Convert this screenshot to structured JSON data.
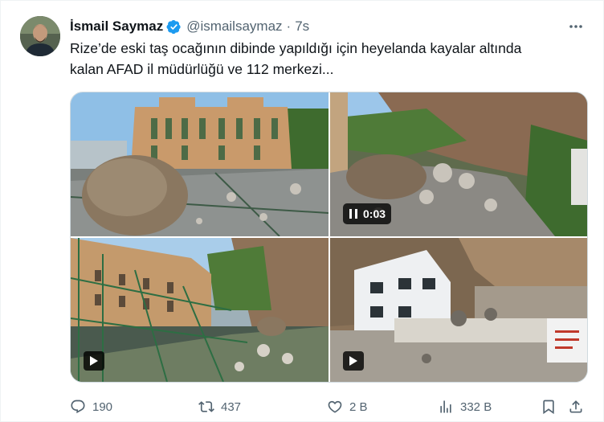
{
  "author": {
    "name": "İsmail Saymaz",
    "handle": "@ismailsaymaz",
    "separator": "·",
    "time": "7s"
  },
  "tweet": {
    "text_line1": "Rize’de eski taş ocağının dibinde yapıldığı için heyelanda kayalar altında",
    "text_line2": "kalan AFAD il müdürlüğü ve 112 merkezi..."
  },
  "media": {
    "video_duration": "0:03"
  },
  "actions": {
    "replies": "190",
    "reposts": "437",
    "likes": "2 B",
    "views": "332 B"
  },
  "icons": [
    "verified-badge-icon",
    "more-icon",
    "pause-icon",
    "play-icon",
    "reply-icon",
    "repost-icon",
    "like-icon",
    "views-icon",
    "bookmark-icon",
    "share-icon"
  ],
  "colors": {
    "verified": "#1d9bf0",
    "secondary_text": "#536471"
  }
}
